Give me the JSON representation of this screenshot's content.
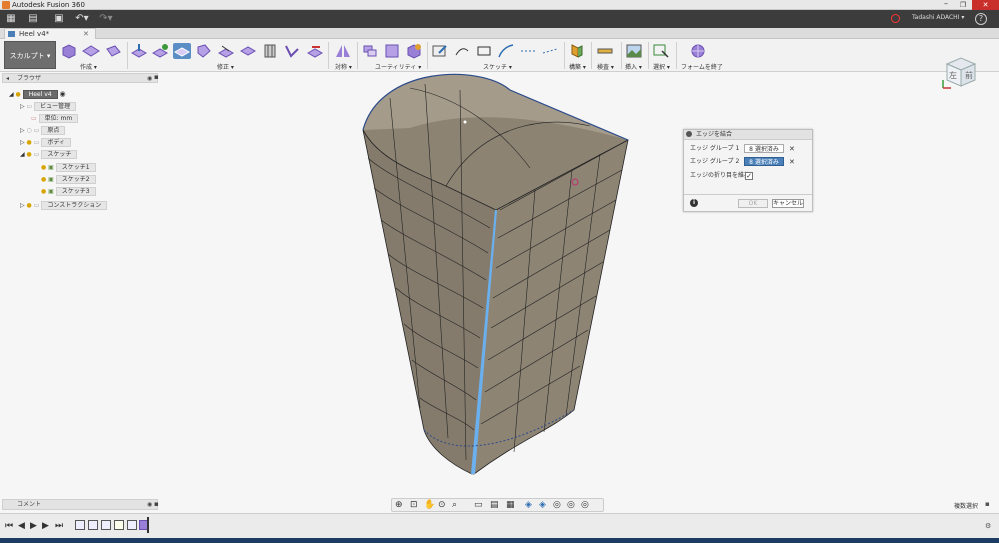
{
  "window": {
    "title": "Autodesk Fusion 360"
  },
  "app_bar": {
    "user": "Tadashi ADACHI ▾",
    "help": "?"
  },
  "document_tab": {
    "label": "Heel v4*"
  },
  "ribbon": {
    "workspace": "スカルプト ▾",
    "groups": [
      {
        "label": "作成 ▾"
      },
      {
        "label": "修正 ▾"
      },
      {
        "label": "対称 ▾"
      },
      {
        "label": "ユーティリティ ▾"
      },
      {
        "label": "スケッチ ▾"
      },
      {
        "label": "構築 ▾"
      },
      {
        "label": "検査 ▾"
      },
      {
        "label": "挿入 ▾"
      },
      {
        "label": "選択 ▾"
      },
      {
        "label": "フォームを終了"
      }
    ]
  },
  "browser": {
    "title": "ブラウザ",
    "items": [
      {
        "label": "Heel v4",
        "level": 0
      },
      {
        "label": "ビュー管理",
        "level": 1
      },
      {
        "label": "単位: mm",
        "level": 1
      },
      {
        "label": "原点",
        "level": 1
      },
      {
        "label": "ボディ",
        "level": 1
      },
      {
        "label": "スケッチ",
        "level": 1
      },
      {
        "label": "スケッチ1",
        "level": 2
      },
      {
        "label": "スケッチ2",
        "level": 2
      },
      {
        "label": "スケッチ3",
        "level": 2
      },
      {
        "label": "コンストラクション",
        "level": 1
      }
    ]
  },
  "dialog": {
    "title": "エッジを結合",
    "edge_group_1_label": "エッジ グループ 1",
    "edge_group_1_value": "8 選択済み",
    "edge_group_2_label": "エッジ グループ 2",
    "edge_group_2_value": "8 選択済み",
    "keep_crease_label": "エッジの折り目を維持",
    "keep_crease_checked": true,
    "ok": "OK",
    "cancel": "キャンセル",
    "close_glyph": "✕",
    "info_glyph": "i"
  },
  "viewcube": {
    "left_face": "左",
    "front_face": "前"
  },
  "comments": {
    "title": "コメント"
  },
  "status": {
    "label": "複数選択"
  },
  "colors": {
    "accent": "#2f6db3",
    "surface": "#8f8676",
    "selected_edge": "#6ab0ee",
    "dialog_selected": "#4a7fb8"
  }
}
